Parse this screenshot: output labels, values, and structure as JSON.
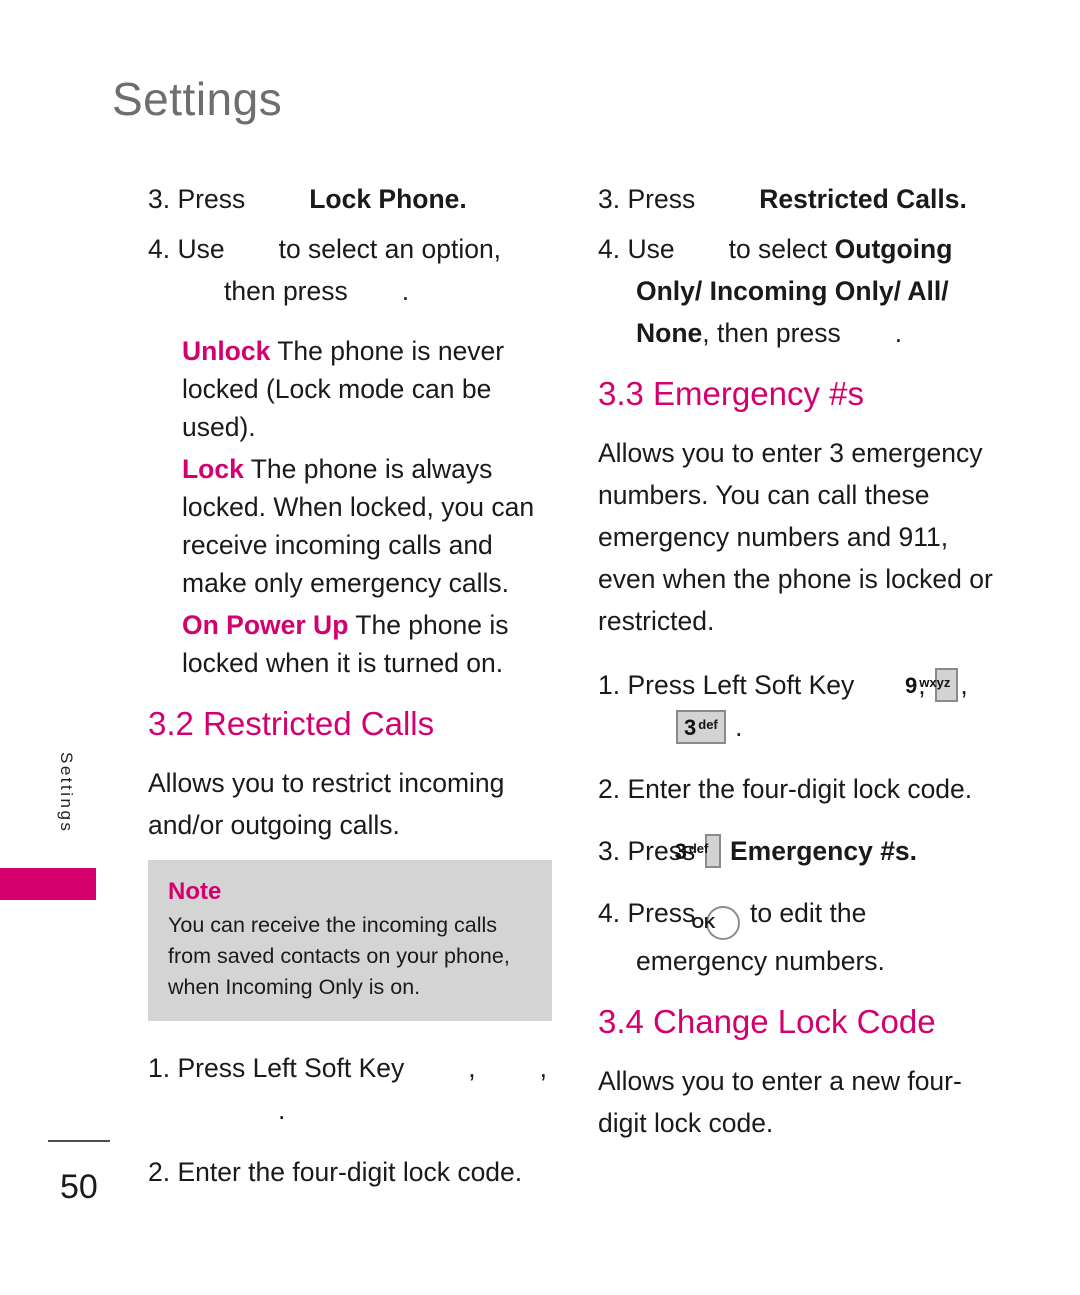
{
  "header": {
    "title": "Settings"
  },
  "side_tab": {
    "label": "Settings",
    "accent_color": "#d4006e"
  },
  "theme": {
    "accent": "#d4006e",
    "title_gray": "#6e6e6e",
    "note_bg": "#d4d4d4",
    "keycap_bg": "#d3d3d3",
    "keycap_border": "#8a8a8a"
  },
  "left_column": {
    "step3": {
      "number": "3. Press",
      "bold_target": "Lock Phone."
    },
    "step4": {
      "lead": "4. Use",
      "middle": "to select an option,",
      "cont": "then press",
      "period": "."
    },
    "options": [
      {
        "term": "Unlock",
        "desc": "The phone is never locked (Lock mode can be used)."
      },
      {
        "term": "Lock",
        "desc": "The phone is always locked. When locked, you can receive incoming calls and make only emergency calls."
      },
      {
        "term": "On Power Up",
        "desc": "The phone is locked when it is turned on."
      }
    ],
    "section_3_2": {
      "heading": "3.2 Restricted Calls",
      "body": "Allows you to restrict incoming and/or outgoing calls."
    },
    "note": {
      "title": "Note",
      "body": "You can receive the incoming calls from saved contacts on your phone, when Incoming Only is on."
    },
    "steps_after_note": {
      "step1_lead": "1. Press Left Soft Key",
      "step1_comma_1": ",",
      "step1_comma_2": ",",
      "step1_period": ".",
      "step2": "2. Enter the four-digit lock code."
    }
  },
  "right_column": {
    "step3": {
      "number": "3. Press",
      "bold_target": "Restricted Calls."
    },
    "step4": {
      "lead": "4. Use",
      "middle": "to select",
      "bold_options": "Outgoing Only/ Incoming Only/ All/ None",
      "cont": ", then press",
      "period": "."
    },
    "section_3_3": {
      "heading": "3.3 Emergency #s",
      "body": "Allows you to enter 3 emergency numbers. You can call these emergency numbers and 911, even when the phone is locked or restricted.",
      "steps": {
        "step1_lead": "1. Press Left Soft Key",
        "step1_comma_1": ",",
        "step1_comma_2": ",",
        "step1_period": ".",
        "step2": "2. Enter the four-digit lock code.",
        "step3_lead": "3. Press",
        "step3_bold": "Emergency #s.",
        "step4_lead": "4. Press",
        "step4_tail": "to edit the emergency numbers."
      }
    },
    "section_3_4": {
      "heading": "3.4 Change Lock Code",
      "body": "Allows you to enter a new four-digit lock code."
    }
  },
  "keys": {
    "key9": {
      "digit": "9",
      "letters": "wxyz"
    },
    "key3": {
      "digit": "3",
      "letters": "def"
    },
    "ok": {
      "label": "OK"
    }
  },
  "footer": {
    "page_number": "50"
  }
}
